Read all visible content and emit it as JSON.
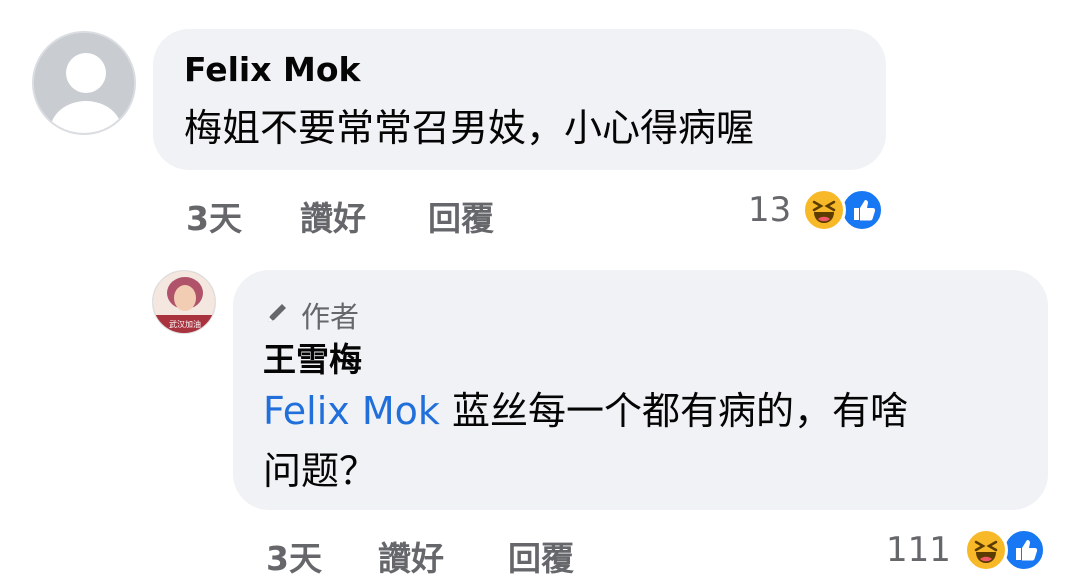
{
  "comment1": {
    "author": "Felix Mok",
    "text": "梅姐不要常常召男妓，小心得病喔",
    "time": "3天",
    "like_label": "讚好",
    "reply_label": "回覆",
    "reaction_count": "13",
    "reactions": [
      "haha-icon",
      "like-icon"
    ]
  },
  "reply1": {
    "badge_label": "作者",
    "author": "王雪梅",
    "mention": "Felix Mok",
    "text_line1": "蓝丝每一个都有病的，有啥",
    "text_line2": "问题？",
    "time": "3天",
    "like_label": "讚好",
    "reply_label": "回覆",
    "reaction_count": "111",
    "reactions": [
      "haha-icon",
      "like-icon"
    ],
    "avatar_caption": "武汉加油"
  },
  "colors": {
    "bubble": "#f0f2f5",
    "meta": "#65676b",
    "mention": "#216fdb",
    "like": "#1877f2",
    "haha": "#f7b928"
  }
}
